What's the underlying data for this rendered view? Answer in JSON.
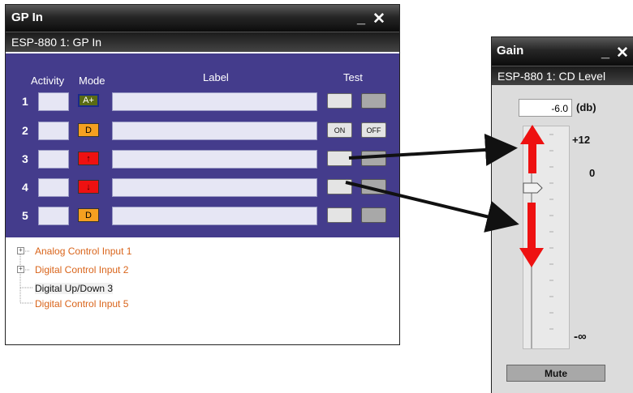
{
  "gp_window": {
    "title": "GP In",
    "controls": "_ X",
    "subtitle": "ESP-880 1: GP In",
    "headers": {
      "activity": "Activity",
      "mode": "Mode",
      "label": "Label",
      "test": "Test"
    },
    "rows": [
      {
        "num": "1",
        "mode": "A+",
        "mode_color": "#5a6b14",
        "test_a": "",
        "test_b": ""
      },
      {
        "num": "2",
        "mode": "D",
        "mode_color": "#f5a020",
        "test_a": "ON",
        "test_b": "OFF"
      },
      {
        "num": "3",
        "mode": "↑",
        "mode_color": "#ee1111",
        "test_a": "",
        "test_b": ""
      },
      {
        "num": "4",
        "mode": "↓",
        "mode_color": "#ee1111",
        "test_a": "",
        "test_b": ""
      },
      {
        "num": "5",
        "mode": "D",
        "mode_color": "#f5a020",
        "test_a": "",
        "test_b": ""
      }
    ],
    "tree": [
      {
        "label": "Analog Control Input 1",
        "expandable": true
      },
      {
        "label": "Digital Control Input 2",
        "expandable": true
      },
      {
        "label": "Digital Up/Down 3",
        "expandable": false
      },
      {
        "label": "Digital Control Input 5",
        "expandable": false
      }
    ]
  },
  "gain_window": {
    "title": "Gain",
    "controls": "_ X",
    "subtitle": "ESP-880 1: CD Level",
    "value": "-6.0",
    "unit": "(db)",
    "scale_top": "+12",
    "scale_mid": "0",
    "scale_bottom": "-∞",
    "mute_label": "Mute"
  },
  "colors": {
    "panel": "#443c8c",
    "orange_text": "#d9641a",
    "arrow_red": "#ee1111"
  }
}
